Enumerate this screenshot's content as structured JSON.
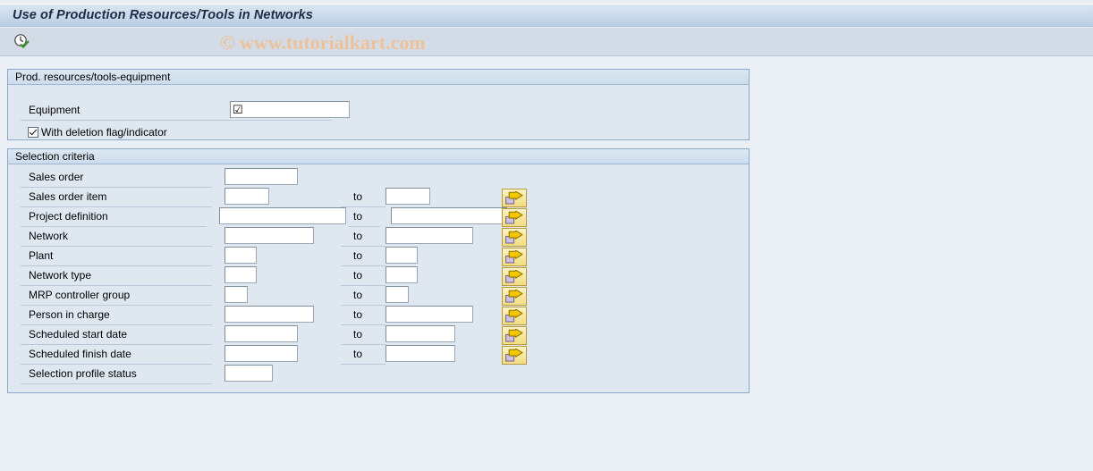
{
  "window": {
    "title": "Use of Production Resources/Tools in Networks"
  },
  "toolbar": {
    "execute_icon": "clock-check-icon",
    "watermark": "© www.tutorialkart.com"
  },
  "equipment_group": {
    "header": "Prod. resources/tools-equipment",
    "equipment_label": "Equipment",
    "equipment_value": "☑",
    "deletion_flag_label": "With deletion flag/indicator",
    "deletion_flag_checked": true
  },
  "selection_group": {
    "header": "Selection criteria",
    "to_label": "to",
    "multi_select_icon": "multiple-selection-arrow-icon",
    "rows": [
      {
        "label": "Sales order",
        "from_value": "",
        "from_width": 82,
        "has_to": false,
        "to_value": "",
        "to_width": 0,
        "has_multi": false
      },
      {
        "label": "Sales order item",
        "from_value": "",
        "from_width": 50,
        "has_to": true,
        "to_value": "",
        "to_width": 50,
        "has_multi": true
      },
      {
        "label": "Project definition",
        "from_value": "",
        "from_width": 142,
        "has_to": true,
        "to_value": "",
        "to_width": 130,
        "has_multi": true
      },
      {
        "label": "Network",
        "from_value": "",
        "from_width": 100,
        "has_to": true,
        "to_value": "",
        "to_width": 98,
        "has_multi": true
      },
      {
        "label": "Plant",
        "from_value": "",
        "from_width": 36,
        "has_to": true,
        "to_value": "",
        "to_width": 36,
        "has_multi": true
      },
      {
        "label": "Network type",
        "from_value": "",
        "from_width": 36,
        "has_to": true,
        "to_value": "",
        "to_width": 36,
        "has_multi": true
      },
      {
        "label": "MRP controller group",
        "from_value": "",
        "from_width": 26,
        "has_to": true,
        "to_value": "",
        "to_width": 26,
        "has_multi": true
      },
      {
        "label": "Person in charge",
        "from_value": "",
        "from_width": 100,
        "has_to": true,
        "to_value": "",
        "to_width": 98,
        "has_multi": true
      },
      {
        "label": "Scheduled start date",
        "from_value": "",
        "from_width": 82,
        "has_to": true,
        "to_value": "",
        "to_width": 78,
        "has_multi": true
      },
      {
        "label": "Scheduled finish date",
        "from_value": "",
        "from_width": 82,
        "has_to": true,
        "to_value": "",
        "to_width": 78,
        "has_multi": true
      },
      {
        "label": "Selection profile status",
        "from_value": "",
        "from_width": 54,
        "has_to": false,
        "to_value": "",
        "to_width": 0,
        "has_multi": false
      }
    ]
  },
  "colors": {
    "title_gradient_top": "#dbe5f1",
    "title_gradient_bottom": "#b9cde4",
    "toolbar_bg": "#d3dce6",
    "page_bg": "#eaeff5",
    "group_bg": "#dfe8f1",
    "group_border": "#8ba9c8",
    "watermark": "#edc29a",
    "button_yellow": "#f7e69b",
    "arrow_yellow": "#f5c500"
  }
}
